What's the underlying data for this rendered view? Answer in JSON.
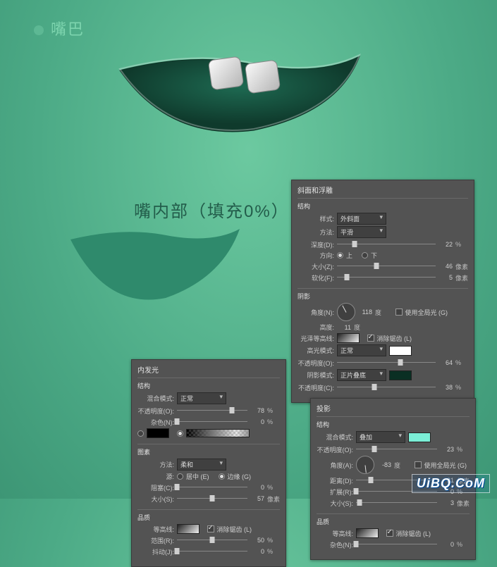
{
  "title": "嘴巴",
  "caption": "嘴内部（填充0%）",
  "bevel": {
    "header": "斜面和浮雕",
    "struct": "结构",
    "style_l": "样式:",
    "style_v": "外斜面",
    "tech_l": "方法:",
    "tech_v": "平滑",
    "depth_l": "深度(D):",
    "depth_v": "22",
    "depth_u": "%",
    "dir_l": "方向:",
    "dir_up": "上",
    "dir_down": "下",
    "size_l": "大小(Z):",
    "size_v": "46",
    "size_u": "像素",
    "soften_l": "软化(F):",
    "soften_v": "5",
    "soften_u": "像素",
    "shade": "阴影",
    "angle_l": "角度(N):",
    "angle_v": "118",
    "angle_u": "度",
    "global_l": "使用全局光 (G)",
    "alt_l": "高度:",
    "alt_v": "11",
    "alt_u": "度",
    "gloss_l": "光泽等高线:",
    "aa_l": "消除锯齿 (L)",
    "hi_mode_l": "高光模式:",
    "hi_mode_v": "正常",
    "hi_op_l": "不透明度(O):",
    "hi_op_v": "64",
    "hi_op_u": "%",
    "sh_mode_l": "阴影模式:",
    "sh_mode_v": "正片叠底",
    "sh_op_l": "不透明度(C):",
    "sh_op_v": "38",
    "sh_op_u": "%"
  },
  "innerglow": {
    "header": "内发光",
    "struct": "结构",
    "mode_l": "混合模式:",
    "mode_v": "正常",
    "op_l": "不透明度(O):",
    "op_v": "78",
    "op_u": "%",
    "noise_l": "杂色(N):",
    "noise_v": "0",
    "noise_u": "%",
    "elements": "图素",
    "tech_l": "方法:",
    "tech_v": "柔和",
    "src_l": "源:",
    "src_center": "居中 (E)",
    "src_edge": "边缘 (G)",
    "choke_l": "阻塞(C):",
    "choke_v": "0",
    "choke_u": "%",
    "size_l": "大小(S):",
    "size_v": "57",
    "size_u": "像素",
    "quality": "品质",
    "contour_l": "等高线:",
    "aa_l": "消除锯齿 (L)",
    "range_l": "范围(R):",
    "range_v": "50",
    "range_u": "%",
    "jitter_l": "抖动(J):",
    "jitter_v": "0",
    "jitter_u": "%"
  },
  "dropshadow": {
    "header": "投影",
    "struct": "结构",
    "mode_l": "混合模式:",
    "mode_v": "叠加",
    "op_l": "不透明度(O):",
    "op_v": "23",
    "op_u": "%",
    "angle_l": "角度(A):",
    "angle_v": "-83",
    "angle_u": "度",
    "global_l": "使用全局光 (G)",
    "dist_l": "距离(D):",
    "dist_v": "21",
    "dist_u": "像素",
    "spread_l": "扩展(R):",
    "spread_v": "0",
    "spread_u": "%",
    "size_l": "大小(S):",
    "size_v": "3",
    "size_u": "像素",
    "quality": "品质",
    "contour_l": "等高线:",
    "aa_l": "消除锯齿 (L)",
    "noise_l": "杂色(N):",
    "noise_v": "0",
    "noise_u": "%"
  },
  "watermark": "UiBQ.CoM"
}
